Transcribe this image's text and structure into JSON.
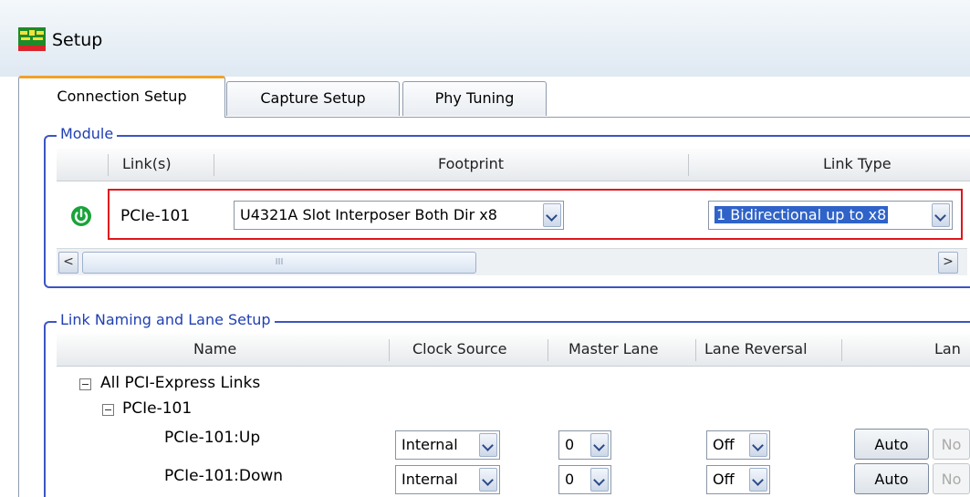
{
  "window": {
    "title": "Setup",
    "icon": "setup-app-icon"
  },
  "tabs": [
    {
      "label": "Connection Setup",
      "active": true
    },
    {
      "label": "Capture Setup",
      "active": false
    },
    {
      "label": "Phy Tuning",
      "active": false
    }
  ],
  "module": {
    "title": "Module",
    "columns": [
      "Link(s)",
      "Footprint",
      "Link Type"
    ],
    "row": {
      "status_icon": "power-on-icon",
      "link": "PCIe-101",
      "footprint": "U4321A Slot Interposer Both Dir x8",
      "link_type": "1 Bidirectional up to x8"
    },
    "scrollbar": {
      "left_arrow": "<",
      "right_arrow": ">",
      "thumb_grip": "III"
    }
  },
  "lane_setup": {
    "title": "Link Naming and Lane Setup",
    "columns": [
      "Name",
      "Clock Source",
      "Master Lane",
      "Lane Reversal",
      "Lan"
    ],
    "tree": {
      "root": "All PCI-Express Links",
      "child": "PCIe-101"
    },
    "rows": [
      {
        "name": "PCIe-101:Up",
        "clock_source": "Internal",
        "master_lane": "0",
        "lane_reversal": "Off",
        "auto_label": "Auto",
        "no_label": "No"
      },
      {
        "name": "PCIe-101:Down",
        "clock_source": "Internal",
        "master_lane": "0",
        "lane_reversal": "Off",
        "auto_label": "Auto",
        "no_label": "No"
      }
    ]
  },
  "colors": {
    "accent_tab": "#f2a12a",
    "group_border": "#3b55c4",
    "highlight_box": "#e0161c",
    "selection": "#2f63c8",
    "power_icon": "#1aa33a"
  }
}
